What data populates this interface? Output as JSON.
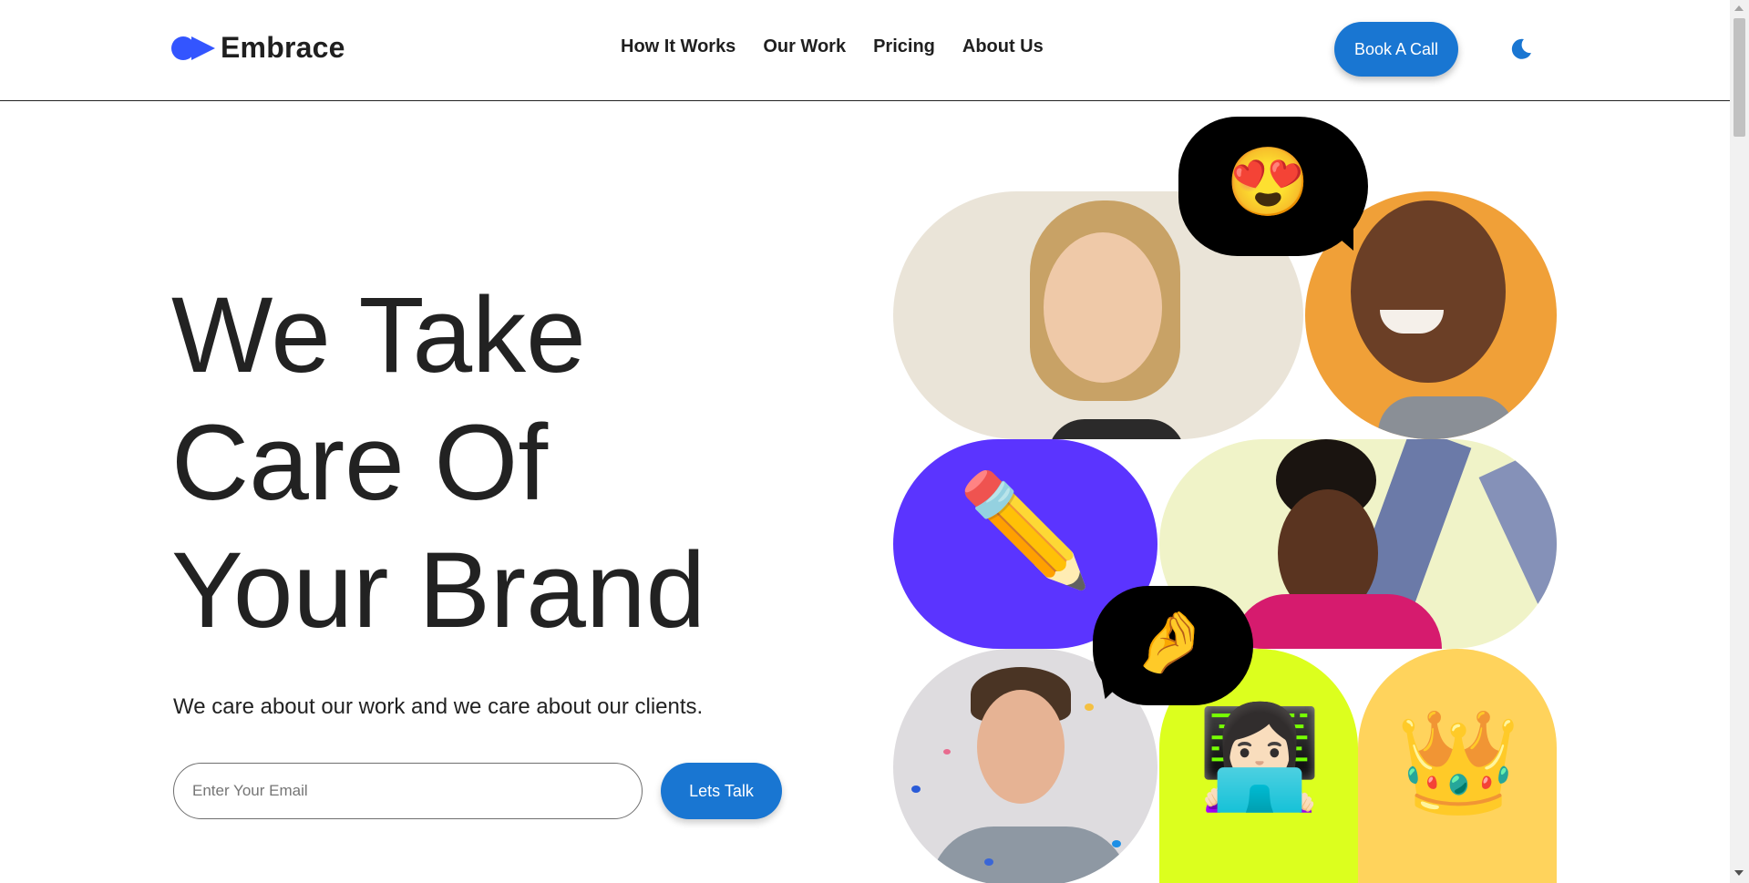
{
  "header": {
    "brand_name": "Embrace",
    "logo_icon": "play-dot-logo-icon",
    "nav": [
      {
        "label": "How It Works"
      },
      {
        "label": "Our Work"
      },
      {
        "label": "Pricing"
      },
      {
        "label": "About Us"
      }
    ],
    "cta_label": "Book A Call",
    "theme_icon": "moon-icon"
  },
  "hero": {
    "title_lines": [
      "We Take",
      "Care Of",
      "Your Brand"
    ],
    "subtitle": "We care about our work and we care about our clients.",
    "email_placeholder": "Enter Your Email",
    "submit_label": "Lets Talk"
  },
  "collage": {
    "emojis": {
      "heart_eyes": "😍",
      "pencil": "✏️",
      "pinch": "🤌",
      "woman_laptop": "👩🏻‍💻",
      "crown": "👑"
    }
  },
  "colors": {
    "accent": "#1976d2",
    "logo": "#3355ff",
    "purple_tile": "#5b34ff",
    "lime_tile": "#dcff1e",
    "yellow_tile": "#ffd35c",
    "orange_tile": "#f0a038",
    "beige_tile": "#eae4d8"
  }
}
